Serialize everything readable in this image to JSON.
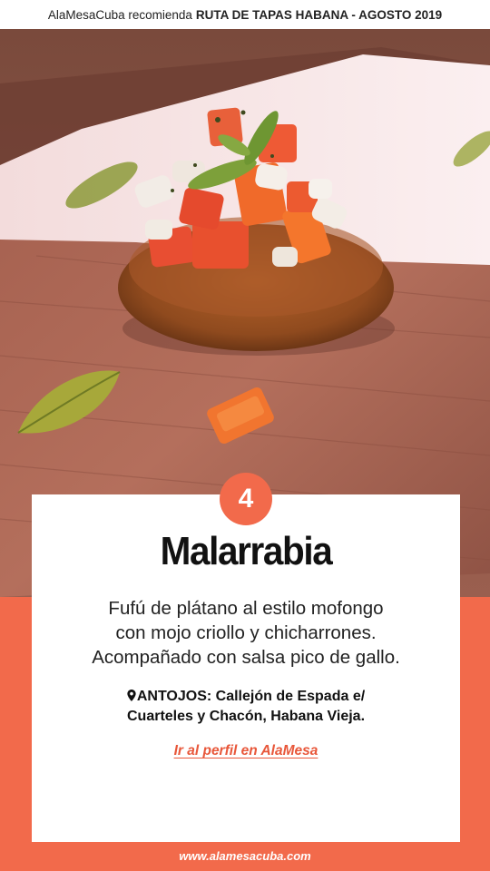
{
  "header": {
    "brand_text": "AlaMesaCuba recomienda",
    "event_text": "RUTA DE TAPAS HABANA - AGOSTO 2019"
  },
  "card": {
    "number": "4",
    "title": "Malarrabia",
    "description_lines": [
      "Fufú de plátano al estilo mofongo",
      "con mojo criollo y chicharrones.",
      "Acompañado con salsa pico de gallo."
    ],
    "address_lines": [
      "ANTOJOS: Callejón de Espada e/",
      "Cuarteles y Chacón, Habana Vieja."
    ],
    "address_icon": "location-pin-icon",
    "profile_link": "Ir al perfil en AlaMesa"
  },
  "footer": {
    "website": "www.alamesacuba.com"
  },
  "colors": {
    "accent": "#f26a4b",
    "link": "#e8573a",
    "card": "#ffffff"
  }
}
